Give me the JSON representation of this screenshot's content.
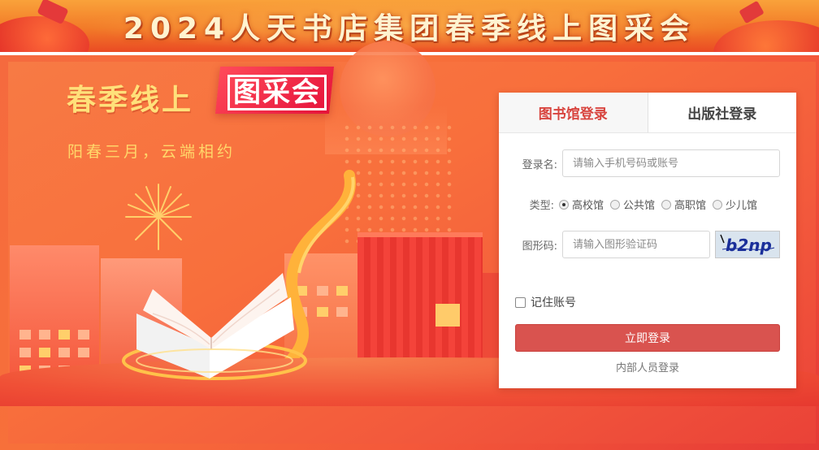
{
  "banner": {
    "title": "2024人天书店集团春季线上图采会"
  },
  "hero": {
    "slogan_main": "春季线上",
    "slogan_box": "图采会",
    "subslogan": "阳春三月，云端相约"
  },
  "login": {
    "tabs": [
      {
        "label": "图书馆登录",
        "active": true
      },
      {
        "label": "出版社登录",
        "active": false
      }
    ],
    "username": {
      "label": "登录名:",
      "placeholder": "请输入手机号码或账号"
    },
    "type": {
      "label": "类型:",
      "options": [
        "高校馆",
        "公共馆",
        "高职馆",
        "少儿馆"
      ],
      "selected": "高校馆"
    },
    "captcha": {
      "label": "图形码:",
      "placeholder": "请输入图形验证码",
      "image_text": "b2np"
    },
    "remember": {
      "label": "记住账号",
      "checked": false
    },
    "submit_label": "立即登录",
    "staff_link": "内部人员登录"
  },
  "colors": {
    "accent_red": "#d9534f",
    "tab_active": "#d8443e",
    "slogan_yellow": "#ffe07a",
    "banner_text": "#fff3d0"
  }
}
